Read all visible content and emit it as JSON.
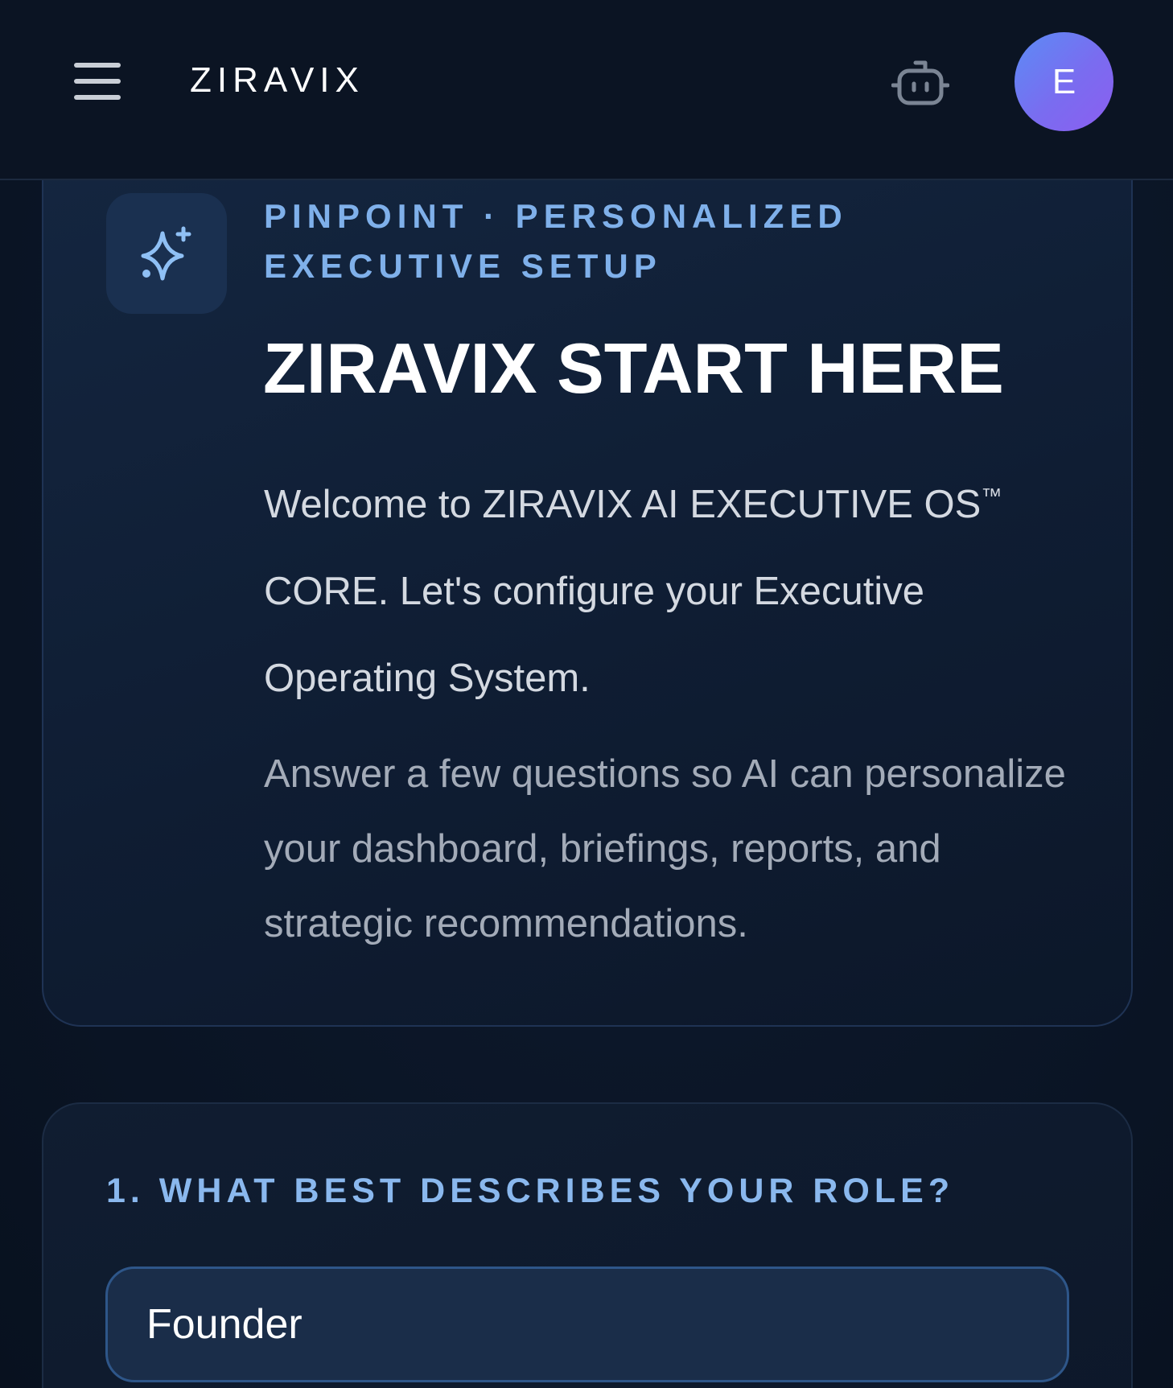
{
  "header": {
    "brand": "ZIRAVIX",
    "avatar_initial": "E",
    "icons": {
      "menu": "hamburger-menu-icon",
      "assistant": "robot-icon"
    }
  },
  "welcome": {
    "eyebrow_line1": "PINPOINT · PERSONALIZED",
    "eyebrow_line2": "EXECUTIVE SETUP",
    "title": "ZIRAVIX START HERE",
    "intro_prefix": "Welcome to ZIRAVIX AI EXECUTIVE OS",
    "intro_trademark": "™",
    "intro_suffix": " CORE. Let's configure your Executive Operating System.",
    "sub_intro": "Answer a few questions so AI can personalize your dashboard, briefings, reports, and strategic recommendations.",
    "icon": "sparkle-icon"
  },
  "question": {
    "label": "1. WHAT BEST DESCRIBES YOUR ROLE?",
    "value": "Founder"
  },
  "colors": {
    "background": "#0a1322",
    "accent": "#7fb0ea",
    "avatar_gradient_start": "#5b8cf5",
    "avatar_gradient_end": "#8c5ef0"
  }
}
